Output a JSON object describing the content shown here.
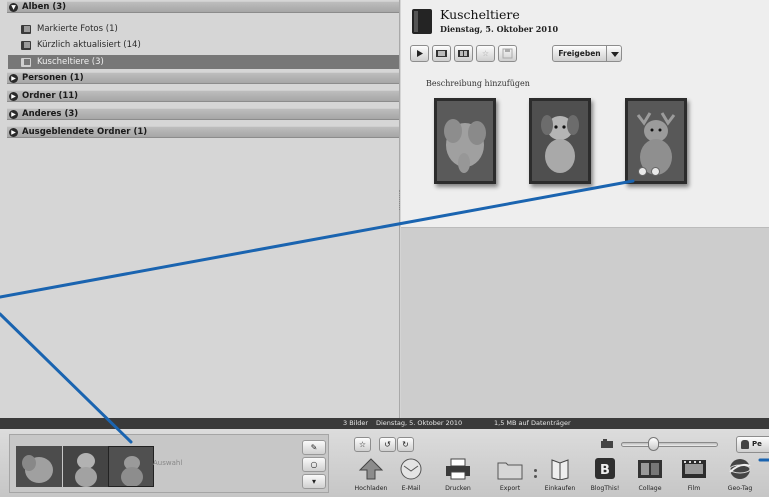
{
  "sidebar": {
    "categories": [
      {
        "label": "Alben (3)",
        "state": "expanded"
      },
      {
        "label": "Personen (1)",
        "state": "collapsed"
      },
      {
        "label": "Ordner (11)",
        "state": "collapsed"
      },
      {
        "label": "Anderes (3)",
        "state": "collapsed"
      },
      {
        "label": "Ausgeblendete Ordner (1)",
        "state": "collapsed"
      }
    ],
    "albums": [
      {
        "label": "Markierte Fotos (1)",
        "selected": false
      },
      {
        "label": "Kürzlich aktualisiert (14)",
        "selected": false
      },
      {
        "label": "Kuscheltiere (3)",
        "selected": true
      }
    ]
  },
  "album_detail": {
    "title": "Kuscheltiere",
    "date": "Dienstag, 5. Oktober 2010",
    "share_label": "Freigeben",
    "add_description": "Beschreibung hinzufügen",
    "photo_count": 3
  },
  "status_bar": {
    "count": "3 Bilder",
    "date": "Dienstag, 5. Oktober 2010",
    "size": "1,5 MB auf Datenträger"
  },
  "bottom_bar": {
    "tray_label": "Auswahl",
    "people_label": "Pe",
    "actions": [
      {
        "label": "Hochladen",
        "icon": "upload-icon"
      },
      {
        "label": "E-Mail",
        "icon": "email-icon"
      },
      {
        "label": "Drucken",
        "icon": "print-icon"
      },
      {
        "label": "Export",
        "icon": "export-folder-icon"
      },
      {
        "label": "Einkaufen",
        "icon": "shop-book-icon"
      },
      {
        "label": "BlogThis!",
        "icon": "blogger-icon"
      },
      {
        "label": "Collage",
        "icon": "collage-icon"
      },
      {
        "label": "Film",
        "icon": "film-icon"
      },
      {
        "label": "Geo-Tag",
        "icon": "geotag-globe-icon"
      }
    ]
  },
  "colors": {
    "callout": "#1a64b0",
    "selected_row": "#777777",
    "status_bar": "#3a3a3a"
  }
}
